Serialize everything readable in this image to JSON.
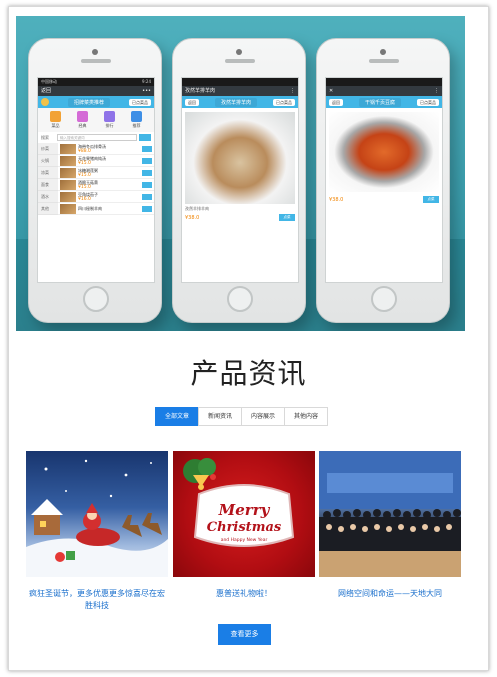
{
  "section": {
    "title": "产品资讯"
  },
  "tabs": [
    {
      "label": "全部文章",
      "active": true
    },
    {
      "label": "新闻资讯",
      "active": false
    },
    {
      "label": "内容展示",
      "active": false
    },
    {
      "label": "其他内容",
      "active": false
    }
  ],
  "news": [
    {
      "caption": "疯狂圣诞节，更多优惠更多惊喜尽在宏胜科技",
      "image": "santa-sleigh"
    },
    {
      "caption": "惠普送礼物啦！",
      "image": "merry-christmas"
    },
    {
      "caption": "网络空间和命运——天地大同",
      "image": "conference-group"
    }
  ],
  "more_button": {
    "label": "查看更多"
  },
  "colors": {
    "accent": "#1a7ee6",
    "link": "#1a6fcc",
    "app_blue": "#42b6e6",
    "price": "#f08300"
  },
  "banner": {
    "phone1": {
      "status": "中国移动",
      "time": "9:24",
      "back": "返回",
      "header": "招牌菜类推荐",
      "badge": "已点菜品",
      "categories": [
        "菜品",
        "经典",
        "排行",
        "推荐"
      ],
      "search_label": "搜索",
      "search_placeholder": "输入搜索关键词",
      "side": [
        "炒菜",
        "火锅",
        "凉菜",
        "面食",
        "酒水",
        "其他"
      ],
      "items": [
        {
          "name": "海带冬瓜排骨汤",
          "price": "¥88.0"
        },
        {
          "name": "无花果猪肉炖汤",
          "price": "¥15.0"
        },
        {
          "name": "冰糖湘莲粥",
          "price": "¥15.0"
        },
        {
          "name": "酒酿玉菇羹",
          "price": "¥15.0"
        },
        {
          "name": "豆角烧茄子",
          "price": "¥16.0"
        },
        {
          "name": "四川秘制羊肉",
          "price": ""
        }
      ]
    },
    "phone2": {
      "header": "孜然羊排羊肉",
      "back": "返回",
      "badge": "已点菜品",
      "caption": "孜然羊排羊肉",
      "price": "¥38.0",
      "order": "点菜"
    },
    "phone3": {
      "header": "干锅千页豆腐",
      "back": "返回",
      "badge": "已点菜品",
      "price": "¥38.0",
      "order": "点菜"
    }
  }
}
